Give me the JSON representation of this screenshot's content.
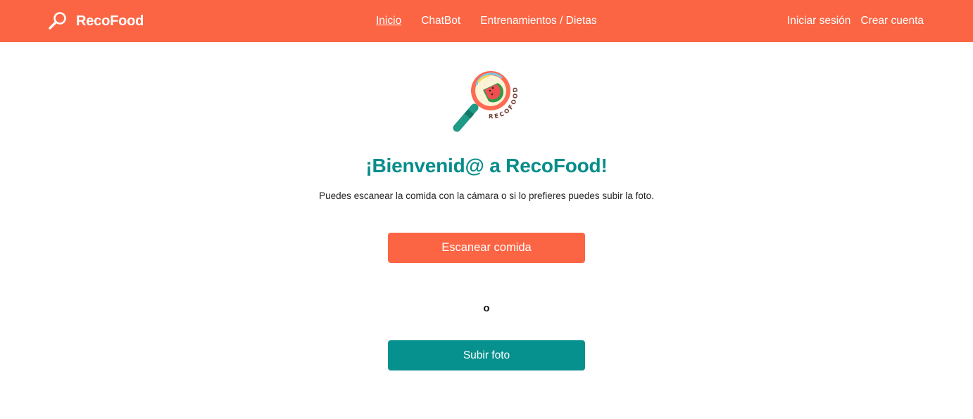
{
  "navbar": {
    "brand": "RecoFood",
    "brand_icon": "magnifier-icon",
    "links": [
      "Inicio",
      "ChatBot",
      "Entrenamientos / Dietas"
    ],
    "active_link": "Inicio",
    "login": "Iniciar sesión",
    "signup": "Crear cuenta",
    "bg_color": "#fc6544"
  },
  "hero": {
    "logo_icon": "watermelon-magnifier-logo",
    "logo_text": "RECOFOOD",
    "title": "¡Bienvenid@ a RecoFood!",
    "subtitle": "Puedes escanear la comida con la cámara o si lo prefieres puedes subir la foto.",
    "title_color": "#078d8b"
  },
  "actions": {
    "scan_label": "Escanear comida",
    "separator": "o",
    "upload_label": "Subir foto",
    "scan_color": "#fc6544",
    "upload_color": "#07918e"
  }
}
